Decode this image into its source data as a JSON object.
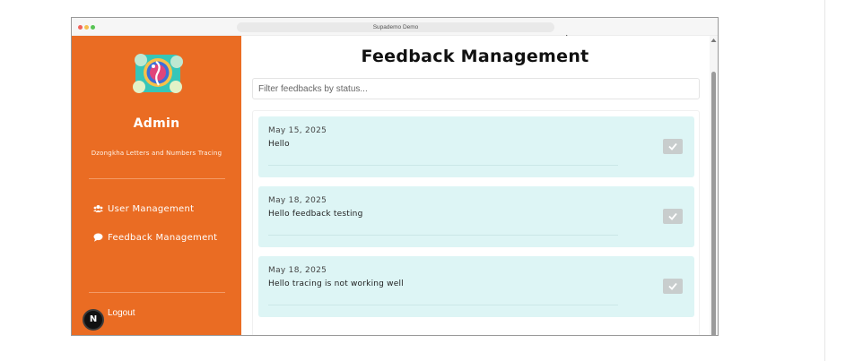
{
  "window": {
    "url_title": "Supademo Demo"
  },
  "sidebar": {
    "title": "Admin",
    "subtitle": "Dzongkha Letters and Numbers Tracing",
    "logo_icon": "tracing-app-logo-icon",
    "items": [
      {
        "label": "User Management",
        "icon": "users-icon"
      },
      {
        "label": "Feedback Management",
        "icon": "comment-icon"
      }
    ],
    "logout_label": "Logout",
    "badge_letter": "N"
  },
  "main": {
    "title": "Feedback Management",
    "filter_placeholder": "Filter feedbacks by status...",
    "feedbacks": [
      {
        "date": "May 15, 2025",
        "message": "Hello"
      },
      {
        "date": "May 18, 2025",
        "message": "Hello feedback testing"
      },
      {
        "date": "May 18, 2025",
        "message": "Hello tracing is not working well"
      }
    ]
  },
  "colors": {
    "sidebar_bg": "#ea6c23",
    "card_bg": "#ddf5f5",
    "check_bg": "#c8cdcd"
  }
}
